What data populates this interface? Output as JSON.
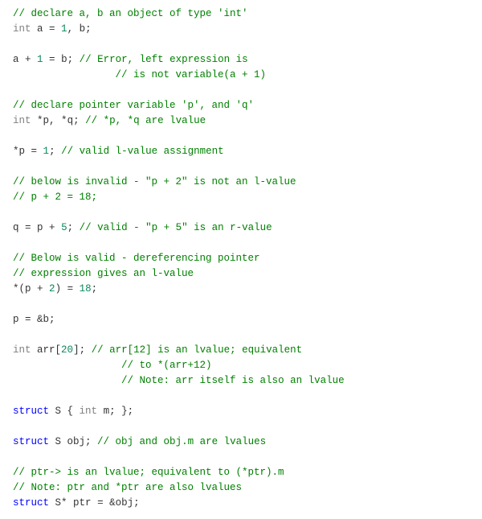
{
  "code": {
    "lines": [
      [
        {
          "cls": "comment",
          "text": "// declare a, b an object of type 'int'"
        }
      ],
      [
        {
          "cls": "keyword",
          "text": "int"
        },
        {
          "cls": "ident",
          "text": " a "
        },
        {
          "cls": "op",
          "text": "= "
        },
        {
          "cls": "num",
          "text": "1"
        },
        {
          "cls": "op",
          "text": ", b;"
        }
      ],
      [],
      [
        {
          "cls": "ident",
          "text": "a "
        },
        {
          "cls": "op",
          "text": "+ "
        },
        {
          "cls": "num",
          "text": "1"
        },
        {
          "cls": "op",
          "text": " = "
        },
        {
          "cls": "ident",
          "text": "b"
        },
        {
          "cls": "op",
          "text": "; "
        },
        {
          "cls": "comment",
          "text": "// Error, left expression is"
        }
      ],
      [
        {
          "cls": "ident",
          "text": "                 "
        },
        {
          "cls": "comment",
          "text": "// is not variable(a + 1)"
        }
      ],
      [],
      [
        {
          "cls": "comment",
          "text": "// declare pointer variable 'p', and 'q'"
        }
      ],
      [
        {
          "cls": "keyword",
          "text": "int"
        },
        {
          "cls": "op",
          "text": " *"
        },
        {
          "cls": "ident",
          "text": "p"
        },
        {
          "cls": "op",
          "text": ", *"
        },
        {
          "cls": "ident",
          "text": "q"
        },
        {
          "cls": "op",
          "text": "; "
        },
        {
          "cls": "comment",
          "text": "// *p, *q are lvalue"
        }
      ],
      [],
      [
        {
          "cls": "op",
          "text": "*"
        },
        {
          "cls": "ident",
          "text": "p "
        },
        {
          "cls": "op",
          "text": "= "
        },
        {
          "cls": "num",
          "text": "1"
        },
        {
          "cls": "op",
          "text": "; "
        },
        {
          "cls": "comment",
          "text": "// valid l-value assignment"
        }
      ],
      [],
      [
        {
          "cls": "comment",
          "text": "// below is invalid - \"p + 2\" is not an l-value "
        }
      ],
      [
        {
          "cls": "comment",
          "text": "// p + 2 = 18;"
        }
      ],
      [],
      [
        {
          "cls": "ident",
          "text": "q "
        },
        {
          "cls": "op",
          "text": "= "
        },
        {
          "cls": "ident",
          "text": "p "
        },
        {
          "cls": "op",
          "text": "+ "
        },
        {
          "cls": "num",
          "text": "5"
        },
        {
          "cls": "op",
          "text": "; "
        },
        {
          "cls": "comment",
          "text": "// valid - \"p + 5\" is an r-value"
        }
      ],
      [],
      [
        {
          "cls": "comment",
          "text": "// Below is valid - dereferencing pointer"
        }
      ],
      [
        {
          "cls": "comment",
          "text": "// expression gives an l-value"
        }
      ],
      [
        {
          "cls": "op",
          "text": "*("
        },
        {
          "cls": "ident",
          "text": "p "
        },
        {
          "cls": "op",
          "text": "+ "
        },
        {
          "cls": "num",
          "text": "2"
        },
        {
          "cls": "op",
          "text": ") = "
        },
        {
          "cls": "num",
          "text": "18"
        },
        {
          "cls": "op",
          "text": ";"
        }
      ],
      [],
      [
        {
          "cls": "ident",
          "text": "p "
        },
        {
          "cls": "op",
          "text": "= &"
        },
        {
          "cls": "ident",
          "text": "b"
        },
        {
          "cls": "op",
          "text": ";"
        }
      ],
      [],
      [
        {
          "cls": "keyword",
          "text": "int"
        },
        {
          "cls": "ident",
          "text": " arr"
        },
        {
          "cls": "op",
          "text": "["
        },
        {
          "cls": "num",
          "text": "20"
        },
        {
          "cls": "op",
          "text": "]; "
        },
        {
          "cls": "comment",
          "text": "// arr[12] is an lvalue; equivalent"
        }
      ],
      [
        {
          "cls": "ident",
          "text": "                  "
        },
        {
          "cls": "comment",
          "text": "// to *(arr+12)"
        }
      ],
      [
        {
          "cls": "ident",
          "text": "                  "
        },
        {
          "cls": "comment",
          "text": "// Note: arr itself is also an lvalue"
        }
      ],
      [],
      [
        {
          "cls": "type",
          "text": "struct"
        },
        {
          "cls": "ident",
          "text": " S "
        },
        {
          "cls": "op",
          "text": "{ "
        },
        {
          "cls": "keyword",
          "text": "int"
        },
        {
          "cls": "ident",
          "text": " m"
        },
        {
          "cls": "op",
          "text": "; };"
        }
      ],
      [],
      [
        {
          "cls": "type",
          "text": "struct"
        },
        {
          "cls": "ident",
          "text": " S obj"
        },
        {
          "cls": "op",
          "text": "; "
        },
        {
          "cls": "comment",
          "text": "// obj and obj.m are lvalues"
        }
      ],
      [],
      [
        {
          "cls": "comment",
          "text": "// ptr-> is an lvalue; equivalent to (*ptr).m"
        }
      ],
      [
        {
          "cls": "comment",
          "text": "// Note: ptr and *ptr are also lvalues"
        }
      ],
      [
        {
          "cls": "type",
          "text": "struct"
        },
        {
          "cls": "ident",
          "text": " S"
        },
        {
          "cls": "op",
          "text": "* "
        },
        {
          "cls": "ident",
          "text": "ptr "
        },
        {
          "cls": "op",
          "text": "= &"
        },
        {
          "cls": "ident",
          "text": "obj"
        },
        {
          "cls": "op",
          "text": ";"
        }
      ]
    ]
  }
}
